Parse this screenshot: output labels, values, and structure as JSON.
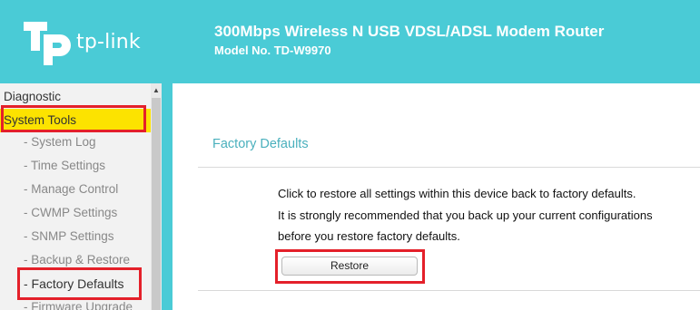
{
  "header": {
    "brand": "tp-link",
    "product_title": "300Mbps Wireless N USB VDSL/ADSL Modem Router",
    "model": "Model No. TD-W9970"
  },
  "sidebar": {
    "items": [
      {
        "label": "Diagnostic",
        "level": "top"
      },
      {
        "label": "System Tools",
        "level": "top",
        "selected": true
      },
      {
        "label": "- System Log",
        "level": "sub"
      },
      {
        "label": "- Time Settings",
        "level": "sub"
      },
      {
        "label": "- Manage Control",
        "level": "sub"
      },
      {
        "label": "- CWMP Settings",
        "level": "sub"
      },
      {
        "label": "- SNMP Settings",
        "level": "sub"
      },
      {
        "label": "- Backup & Restore",
        "level": "sub"
      },
      {
        "label": "- Factory Defaults",
        "level": "sub",
        "selected": true
      },
      {
        "label": "- Firmware Upgrade",
        "level": "sub"
      }
    ]
  },
  "main": {
    "section_title": "Factory Defaults",
    "lines": [
      "Click to restore all settings within this device back to factory defaults.",
      "It is strongly recommended that you back up your current configurations",
      "before you restore factory defaults."
    ],
    "restore_label": "Restore"
  },
  "colors": {
    "header_bg": "#4acbd6",
    "highlight": "#fce300",
    "annotation_red": "#e4202a",
    "title_teal": "#4ab0bd"
  }
}
